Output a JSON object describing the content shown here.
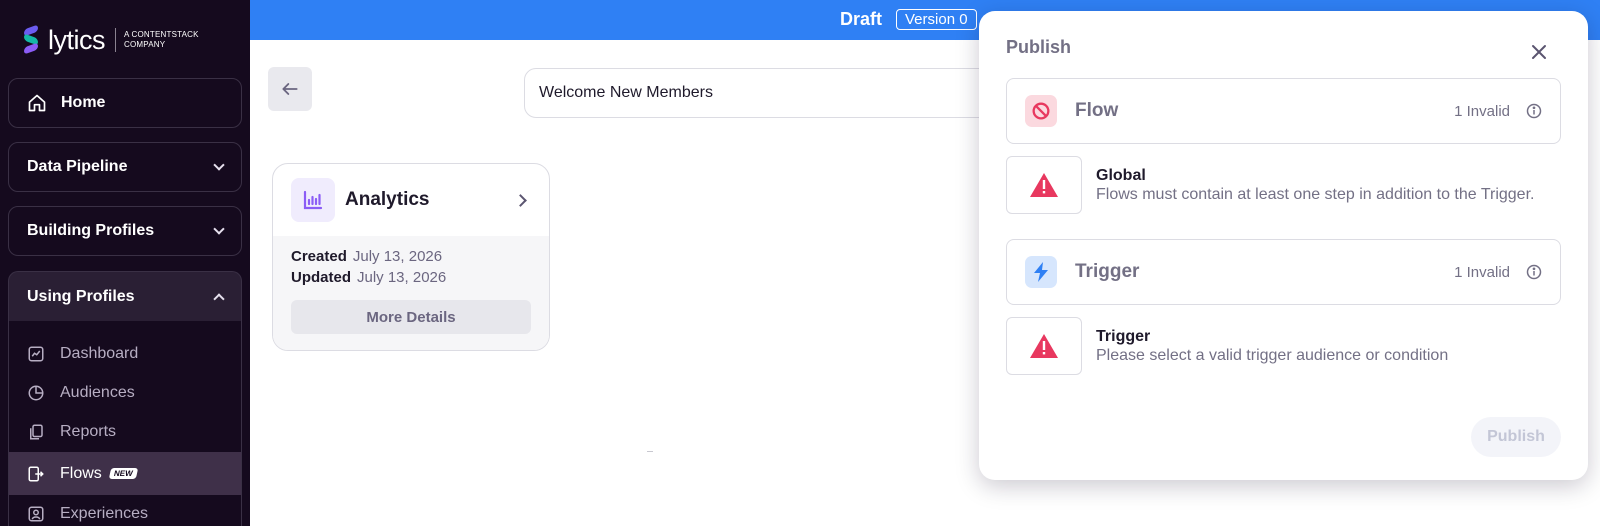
{
  "brand": {
    "logo_text": "lytics",
    "logo_subtext_1": "A CONTENTSTACK",
    "logo_subtext_2": "COMPANY"
  },
  "sidebar": {
    "home": "Home",
    "data_pipeline": "Data Pipeline",
    "building_profiles": "Building Profiles",
    "using_profiles": "Using Profiles",
    "sub_items": [
      {
        "label": "Dashboard",
        "icon": "chart-line-icon"
      },
      {
        "label": "Audiences",
        "icon": "pie-chart-icon"
      },
      {
        "label": "Reports",
        "icon": "copy-icon"
      },
      {
        "label": "Flows",
        "icon": "flow-exit-icon",
        "badge": "NEW",
        "active": true
      },
      {
        "label": "Experiences",
        "icon": "user-square-icon"
      }
    ]
  },
  "topbar": {
    "status": "Draft",
    "version": "Version 0"
  },
  "main": {
    "flow_name": "Welcome New Members",
    "card": {
      "title": "Analytics",
      "created_label": "Created",
      "created_value": "July 13, 2026",
      "updated_label": "Updated",
      "updated_value": "July 13, 2026",
      "more_details": "More Details"
    }
  },
  "publish_panel": {
    "title": "Publish",
    "sections": [
      {
        "label": "Flow",
        "status": "1 Invalid",
        "icon": "no-entry-icon",
        "color": "#e8385f",
        "error_title": "Global",
        "error_desc": "Flows must contain at least one step in addition to the Trigger."
      },
      {
        "label": "Trigger",
        "status": "1 Invalid",
        "icon": "lightning-icon",
        "color": "#2f80f4",
        "error_title": "Trigger",
        "error_desc": "Please select a valid trigger audience or condition"
      }
    ],
    "publish_button": "Publish"
  },
  "colors": {
    "sidebar_bg": "#150a1e",
    "topbar_bg": "#2f80f4",
    "error": "#e8385f",
    "accent": "#8b5cf6"
  }
}
